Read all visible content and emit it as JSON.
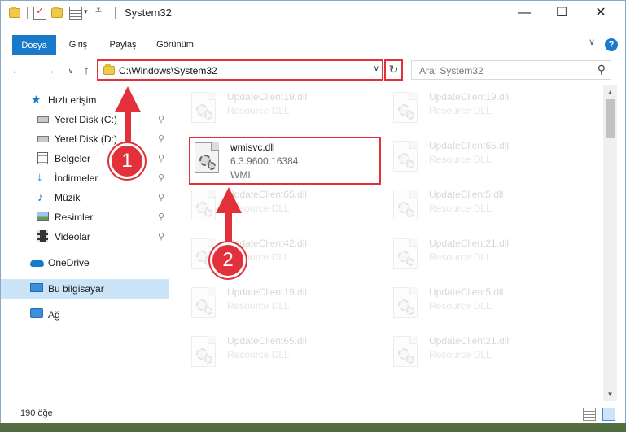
{
  "window": {
    "title": "System32",
    "controls": {
      "minimize": "—",
      "maximize": "☐",
      "close": "✕"
    }
  },
  "ribbon": {
    "tabs": [
      "Dosya",
      "Giriş",
      "Paylaş",
      "Görünüm"
    ],
    "expand": "∨",
    "help": "?"
  },
  "address_bar": {
    "back": "←",
    "forward": "→",
    "recent": "∨",
    "up": "↑",
    "path": "C:\\Windows\\System32",
    "dropdown": "∨",
    "refresh": "↻"
  },
  "search": {
    "placeholder": "Ara: System32",
    "icon": "search-icon"
  },
  "sidebar": {
    "items": [
      {
        "label": "Hızlı erişim",
        "icon": "star-icon",
        "pinned": false
      },
      {
        "label": "Yerel Disk (C:)",
        "icon": "drive-icon",
        "pinned": true
      },
      {
        "label": "Yerel Disk (D:)",
        "icon": "drive-icon",
        "pinned": true
      },
      {
        "label": "Belgeler",
        "icon": "documents-icon",
        "pinned": true
      },
      {
        "label": "İndirmeler",
        "icon": "download-icon",
        "pinned": true
      },
      {
        "label": "Müzik",
        "icon": "music-icon",
        "pinned": true
      },
      {
        "label": "Resimler",
        "icon": "pictures-icon",
        "pinned": true
      },
      {
        "label": "Videolar",
        "icon": "video-icon",
        "pinned": true
      },
      {
        "label": "OneDrive",
        "icon": "cloud-icon",
        "pinned": false
      },
      {
        "label": "Bu bilgisayar",
        "icon": "computer-icon",
        "pinned": false,
        "selected": true
      },
      {
        "label": "Ağ",
        "icon": "network-icon",
        "pinned": false
      }
    ],
    "pin_glyph": "📌"
  },
  "files": {
    "highlighted": {
      "name": "wmisvc.dll",
      "version": "6.3.9600.16384",
      "description": "WMI"
    },
    "left_column": [
      {
        "name": "UpdateClient19.dll",
        "type": "Resource DLL"
      },
      {
        "name": "UpdateClient65.dll",
        "type": "Resource DLL"
      },
      {
        "name": "UpdateClient42.dll",
        "type": "Resource DLL"
      },
      {
        "name": "UpdateClient19.dll",
        "type": "Resource DLL"
      },
      {
        "name": "UpdateClient65.dll",
        "type": "Resource DLL"
      }
    ],
    "right_column": [
      {
        "name": "UpdateClient19.dll",
        "type": "Resource DLL"
      },
      {
        "name": "UpdateClient65.dll",
        "type": "Resource DLL"
      },
      {
        "name": "UpdateClient5.dll",
        "type": "Resource DLL"
      },
      {
        "name": "UpdateClient21.dll",
        "type": "Resource DLL"
      },
      {
        "name": "UpdateClient5.dll",
        "type": "Resource DLL"
      },
      {
        "name": "UpdateClient21.dll",
        "type": "Resource DLL"
      }
    ]
  },
  "status_bar": {
    "item_count": "190 öğe"
  },
  "annotations": {
    "step1": "1",
    "step2": "2",
    "color": "#e2313a"
  }
}
